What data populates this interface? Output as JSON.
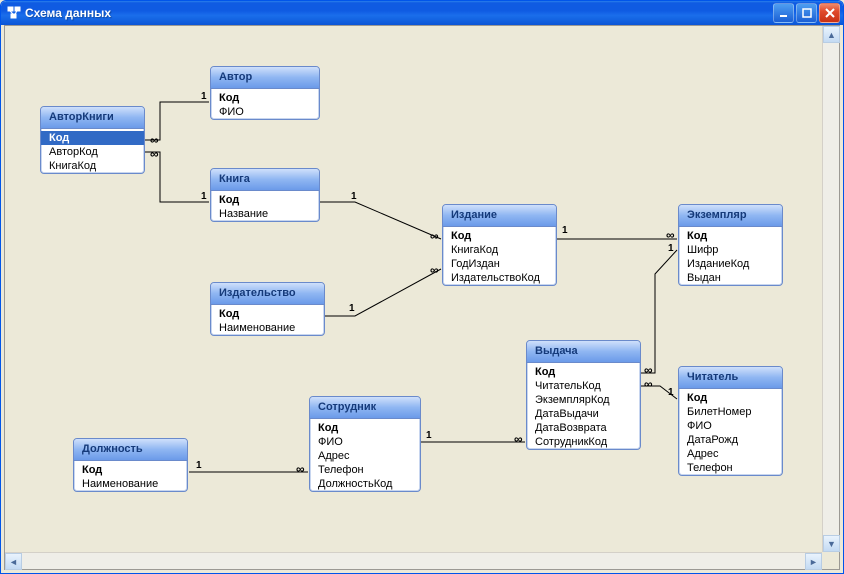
{
  "window": {
    "title": "Схема данных",
    "min_tooltip": "Свернуть",
    "max_tooltip": "Развернуть",
    "close_tooltip": "Закрыть"
  },
  "entities": {
    "avtorknigi": {
      "title": "АвторКниги",
      "fields": [
        "Код",
        "АвторКод",
        "КнигаКод"
      ],
      "pk": [
        0
      ],
      "selected": 0
    },
    "avtor": {
      "title": "Автор",
      "fields": [
        "Код",
        "ФИО"
      ],
      "pk": [
        0
      ]
    },
    "kniga": {
      "title": "Книга",
      "fields": [
        "Код",
        "Название"
      ],
      "pk": [
        0
      ]
    },
    "izdatelstvo": {
      "title": "Издательство",
      "fields": [
        "Код",
        "Наименование"
      ],
      "pk": [
        0
      ]
    },
    "izdanie": {
      "title": "Издание",
      "fields": [
        "Код",
        "КнигаКод",
        "ГодИздан",
        "ИздательствоКод"
      ],
      "pk": [
        0
      ]
    },
    "sotrudnik": {
      "title": "Сотрудник",
      "fields": [
        "Код",
        "ФИО",
        "Адрес",
        "Телефон",
        "ДолжностьКод"
      ],
      "pk": [
        0
      ]
    },
    "dolzhnost": {
      "title": "Должность",
      "fields": [
        "Код",
        "Наименование"
      ],
      "pk": [
        0
      ]
    },
    "vydacha": {
      "title": "Выдача",
      "fields": [
        "Код",
        "ЧитательКод",
        "ЭкземплярКод",
        "ДатаВыдачи",
        "ДатаВозврата",
        "СотрудникКод"
      ],
      "pk": [
        0
      ]
    },
    "chitatel": {
      "title": "Читатель",
      "fields": [
        "Код",
        "БилетНомер",
        "ФИО",
        "ДатаРожд",
        "Адрес",
        "Телефон"
      ],
      "pk": [
        0
      ]
    },
    "ekzemplyar": {
      "title": "Экземпляр",
      "fields": [
        "Код",
        "Шифр",
        "ИзданиеКод",
        "Выдан"
      ],
      "pk": [
        0
      ]
    }
  },
  "cardinality": {
    "one": "1",
    "many": "∞"
  },
  "relationships": [
    {
      "from": "avtorknigi",
      "from_card": "many",
      "to": "avtor",
      "to_card": "one"
    },
    {
      "from": "avtorknigi",
      "from_card": "many",
      "to": "kniga",
      "to_card": "one"
    },
    {
      "from": "izdanie",
      "from_card": "many",
      "to": "kniga",
      "to_card": "one"
    },
    {
      "from": "izdanie",
      "from_card": "many",
      "to": "izdatelstvo",
      "to_card": "one"
    },
    {
      "from": "ekzemplyar",
      "from_card": "many",
      "to": "izdanie",
      "to_card": "one"
    },
    {
      "from": "vydacha",
      "from_card": "many",
      "to": "ekzemplyar",
      "to_card": "one"
    },
    {
      "from": "vydacha",
      "from_card": "many",
      "to": "chitatel",
      "to_card": "one"
    },
    {
      "from": "vydacha",
      "from_card": "many",
      "to": "sotrudnik",
      "to_card": "one"
    },
    {
      "from": "sotrudnik",
      "from_card": "many",
      "to": "dolzhnost",
      "to_card": "one"
    }
  ]
}
